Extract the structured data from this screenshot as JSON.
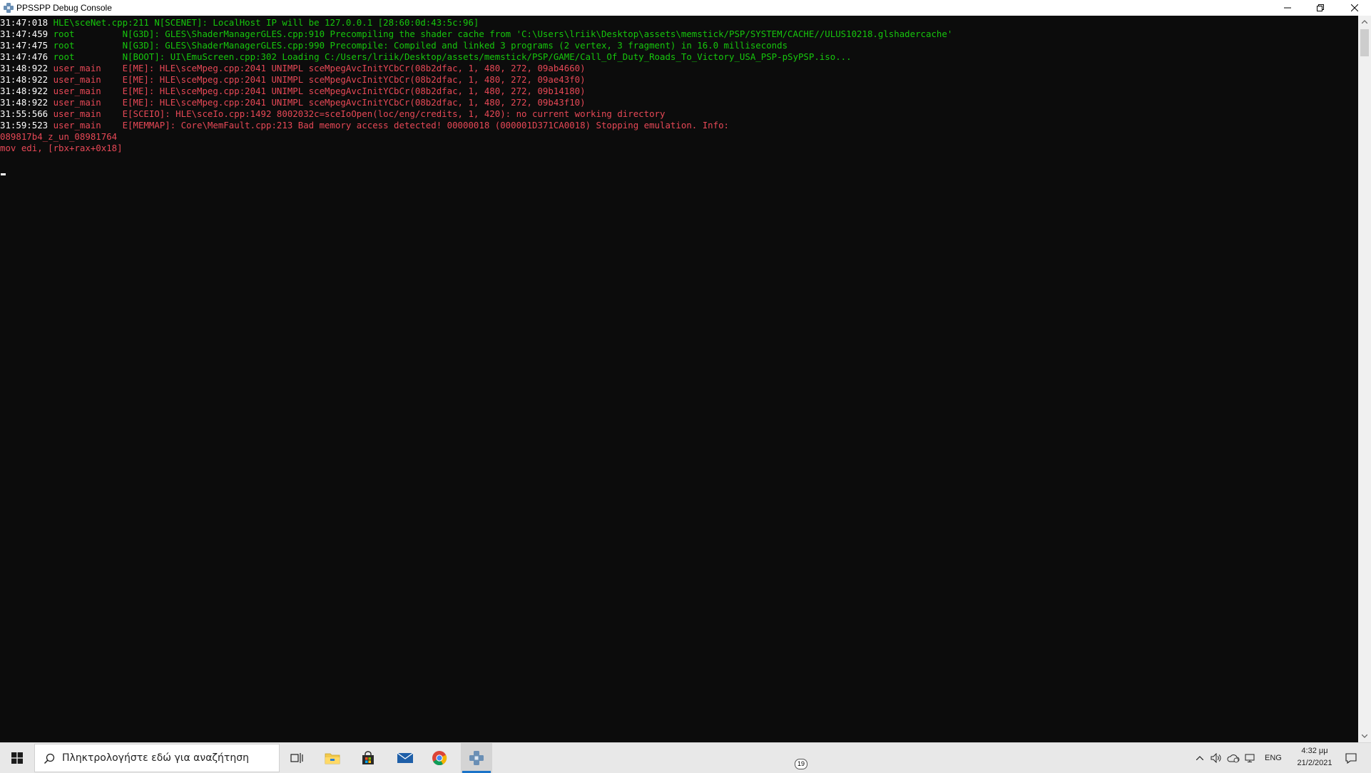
{
  "window": {
    "title": "PPSSPP Debug Console"
  },
  "console": {
    "lines": [
      {
        "time": "31:47:018",
        "rest": " HLE\\sceNet.cpp:211 N[SCENET]: LocalHost IP will be 127.0.0.1 [28:60:0d:43:5c:96]",
        "color": "green"
      },
      {
        "time": "31:47:459",
        "rest": " root         N[G3D]: GLES\\ShaderManagerGLES.cpp:910 Precompiling the shader cache from 'C:\\Users\\lriik\\Desktop\\assets\\memstick/PSP/SYSTEM/CACHE//ULUS10218.glshadercache'",
        "color": "green"
      },
      {
        "time": "31:47:475",
        "rest": " root         N[G3D]: GLES\\ShaderManagerGLES.cpp:990 Precompile: Compiled and linked 3 programs (2 vertex, 3 fragment) in 16.0 milliseconds",
        "color": "green"
      },
      {
        "time": "31:47:476",
        "rest": " root         N[BOOT]: UI\\EmuScreen.cpp:302 Loading C:/Users/lriik/Desktop/assets/memstick/PSP/GAME/Call_Of_Duty_Roads_To_Victory_USA_PSP-pSyPSP.iso...",
        "color": "green"
      },
      {
        "time": "31:48:922",
        "rest": " user_main    E[ME]: HLE\\sceMpeg.cpp:2041 UNIMPL sceMpegAvcInitYCbCr(08b2dfac, 1, 480, 272, 09ab4660)",
        "color": "red"
      },
      {
        "time": "31:48:922",
        "rest": " user_main    E[ME]: HLE\\sceMpeg.cpp:2041 UNIMPL sceMpegAvcInitYCbCr(08b2dfac, 1, 480, 272, 09ae43f0)",
        "color": "red"
      },
      {
        "time": "31:48:922",
        "rest": " user_main    E[ME]: HLE\\sceMpeg.cpp:2041 UNIMPL sceMpegAvcInitYCbCr(08b2dfac, 1, 480, 272, 09b14180)",
        "color": "red"
      },
      {
        "time": "31:48:922",
        "rest": " user_main    E[ME]: HLE\\sceMpeg.cpp:2041 UNIMPL sceMpegAvcInitYCbCr(08b2dfac, 1, 480, 272, 09b43f10)",
        "color": "red"
      },
      {
        "time": "31:55:566",
        "rest": " user_main    E[SCEIO]: HLE\\sceIo.cpp:1492 8002032c=sceIoOpen(loc/eng/credits, 1, 420): no current working directory",
        "color": "red"
      },
      {
        "time": "31:59:523",
        "rest": " user_main    E[MEMMAP]: Core\\MemFault.cpp:213 Bad memory access detected! 00000018 (000001D371CA0018) Stopping emulation. Info:",
        "color": "red"
      },
      {
        "time": "",
        "rest": "089817b4_z_un_08981764",
        "color": "red"
      },
      {
        "time": "",
        "rest": "mov edi, [rbx+rax+0x18]",
        "color": "red"
      }
    ]
  },
  "taskbar": {
    "search_placeholder": "Πληκτρολογήστε εδώ για αναζήτηση",
    "mail_badge": "19",
    "language": "ENG",
    "time": "4:32 μμ",
    "date": "21/2/2021",
    "icons": [
      "windows-start-icon",
      "search-icon",
      "task-view-icon",
      "file-explorer-icon",
      "store-icon",
      "mail-icon",
      "chrome-icon",
      "ppsspp-icon"
    ]
  },
  "colors": {
    "console_bg": "#0c0c0c",
    "green": "#16c60c",
    "red": "#e74856",
    "timestamp": "#ffffff",
    "taskbar_bg": "#e8e8e8",
    "accent": "#1a73c8"
  }
}
